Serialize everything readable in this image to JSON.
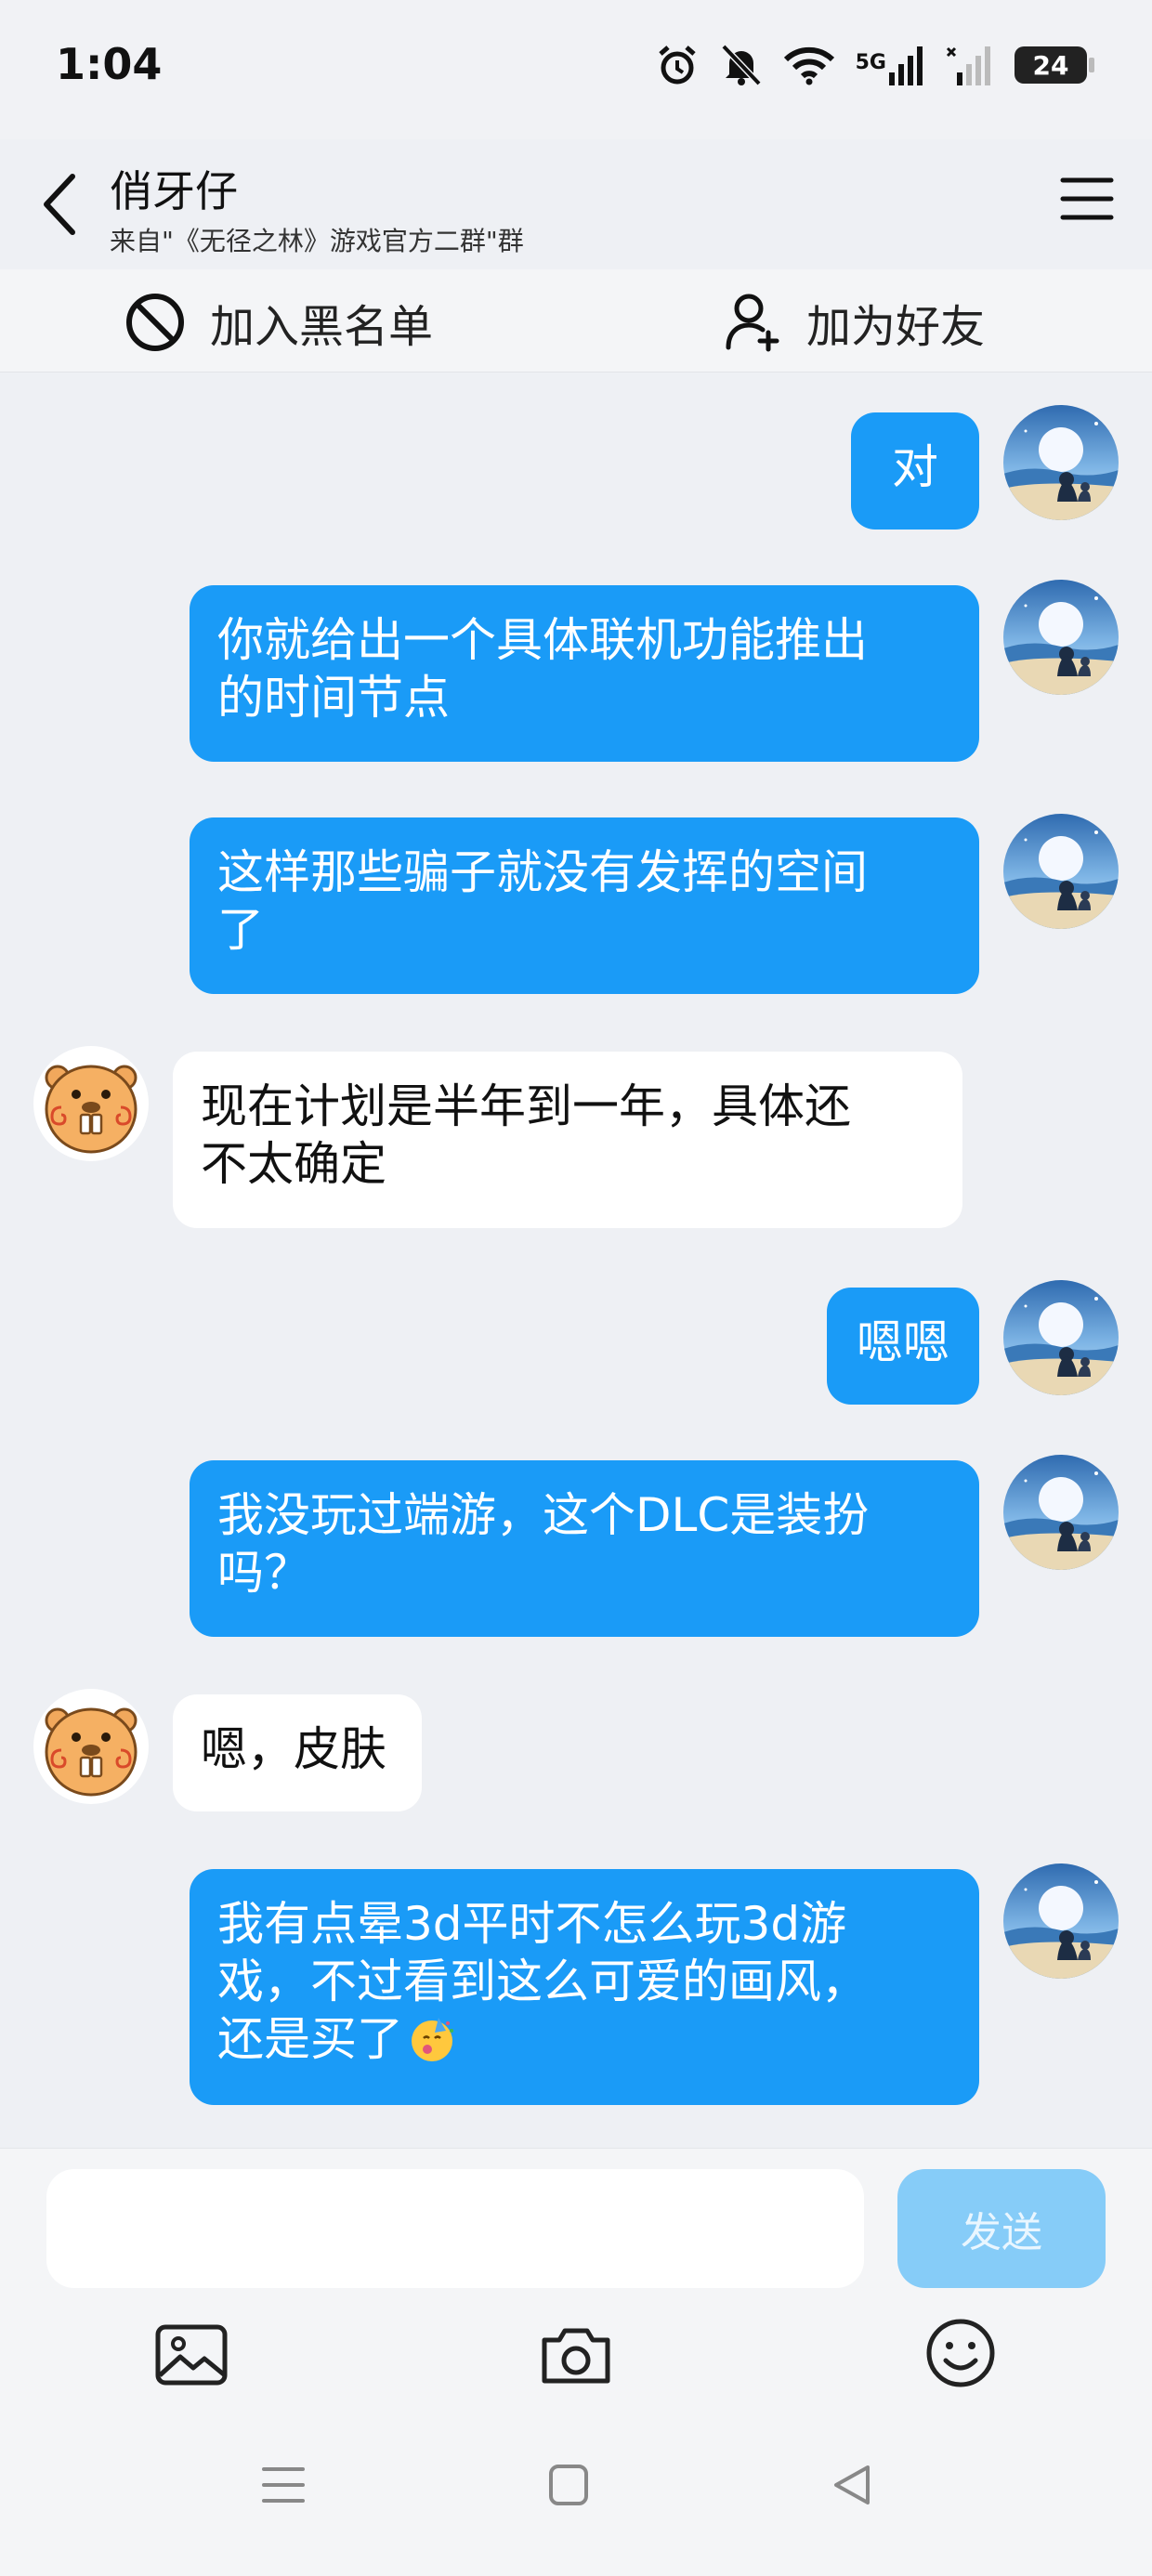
{
  "status_bar": {
    "time": "1:04",
    "network": "5G",
    "battery": "24"
  },
  "header": {
    "title": "俏牙仔",
    "subtitle": "来自\"《无径之林》游戏官方二群\"群"
  },
  "actions": {
    "block_label": "加入黑名单",
    "add_friend_label": "加为好友"
  },
  "messages": [
    {
      "sender": "me",
      "lines": [
        "对"
      ]
    },
    {
      "sender": "me",
      "lines": [
        "你就给出一个具体联机功能推出",
        "的时间节点"
      ]
    },
    {
      "sender": "me",
      "lines": [
        "这样那些骗子就没有发挥的空间",
        "了"
      ]
    },
    {
      "sender": "them",
      "lines": [
        "现在计划是半年到一年，具体还",
        "不太确定"
      ]
    },
    {
      "sender": "me",
      "lines": [
        "嗯嗯"
      ]
    },
    {
      "sender": "me",
      "lines": [
        "我没玩过端游，这个DLC是装扮",
        "吗？"
      ]
    },
    {
      "sender": "them",
      "lines": [
        "嗯，皮肤"
      ]
    },
    {
      "sender": "me",
      "lines": [
        "我有点晕3d平时不怎么玩3d游",
        "戏，不过看到这么可爱的画风，",
        "还是买了"
      ]
    }
  ],
  "input": {
    "placeholder": "",
    "send_label": "发送"
  },
  "colors": {
    "my_bubble": "#1a9bf7",
    "their_bubble": "#ffffff",
    "send_disabled": "#86ccf8"
  }
}
